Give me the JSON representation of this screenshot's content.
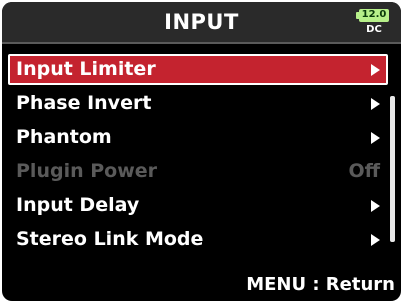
{
  "header": {
    "title": "INPUT",
    "battery": {
      "value": "12.0",
      "source": "DC",
      "color": "#b7f08a",
      "icon": "battery-icon"
    }
  },
  "menu": {
    "items": [
      {
        "label": "Input Limiter",
        "selected": true,
        "enabled": true,
        "icon": "chevron-right-icon"
      },
      {
        "label": "Phase Invert",
        "selected": false,
        "enabled": true,
        "icon": "chevron-right-icon"
      },
      {
        "label": "Phantom",
        "selected": false,
        "enabled": true,
        "icon": "chevron-right-icon"
      },
      {
        "label": "Plugin Power",
        "selected": false,
        "enabled": false,
        "value": "Off"
      },
      {
        "label": "Input Delay",
        "selected": false,
        "enabled": true,
        "icon": "chevron-right-icon"
      },
      {
        "label": "Stereo Link Mode",
        "selected": false,
        "enabled": true,
        "icon": "chevron-right-icon"
      }
    ]
  },
  "footer": {
    "hint": "MENU : Return"
  },
  "colors": {
    "selection": "#c4232f",
    "background": "#000000",
    "disabled_text": "#5a5a5a"
  }
}
